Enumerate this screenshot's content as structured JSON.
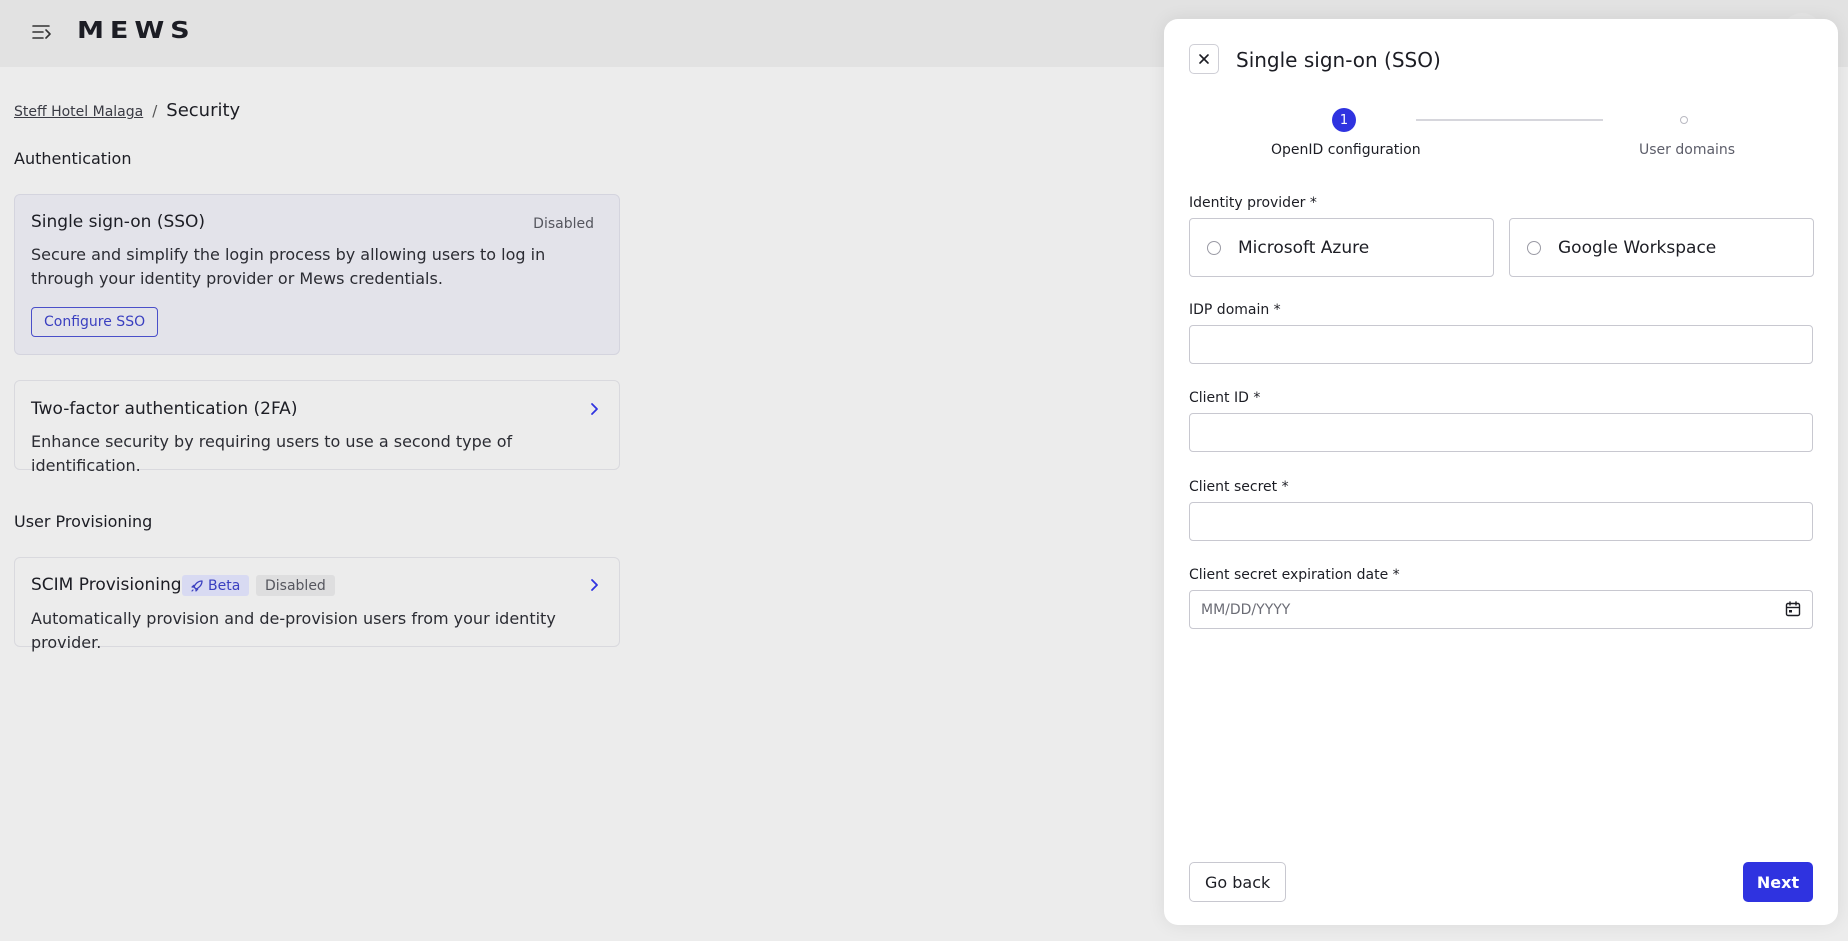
{
  "app": {
    "logo_text": "MEWS"
  },
  "breadcrumb": {
    "parent": "Steff Hotel Malaga",
    "separator": "/",
    "current": "Security"
  },
  "sections": {
    "authentication": "Authentication",
    "user_provisioning": "User Provisioning"
  },
  "sso_card": {
    "title": "Single sign-on (SSO)",
    "status": "Disabled",
    "description": "Secure and simplify the login process by allowing users to log in through your identity provider or Mews credentials.",
    "button": "Configure SSO"
  },
  "twofa_card": {
    "title": "Two-factor authentication (2FA)",
    "description": "Enhance security by requiring users to use a second type of identification."
  },
  "scim_card": {
    "title": "SCIM Provisioning",
    "beta_badge": "Beta",
    "status_badge": "Disabled",
    "description": "Automatically provision and de-provision users from your identity provider."
  },
  "panel": {
    "title": "Single sign-on (SSO)",
    "stepper": {
      "steps": [
        {
          "number": "1",
          "label": "OpenID configuration",
          "active": true
        },
        {
          "number": "",
          "label": "User domains",
          "active": false
        }
      ]
    },
    "identity_provider": {
      "label": "Identity provider *",
      "options": [
        "Microsoft Azure",
        "Google Workspace"
      ]
    },
    "idp_domain": {
      "label": "IDP domain *",
      "value": ""
    },
    "client_id": {
      "label": "Client ID *",
      "value": ""
    },
    "client_secret": {
      "label": "Client secret *",
      "value": ""
    },
    "expiration": {
      "label": "Client secret expiration date *",
      "placeholder": "MM/DD/YYYY"
    },
    "buttons": {
      "back": "Go back",
      "next": "Next"
    }
  },
  "colors": {
    "accent": "#2f33e0",
    "link": "#3a3fc0",
    "background": "#ececec"
  }
}
